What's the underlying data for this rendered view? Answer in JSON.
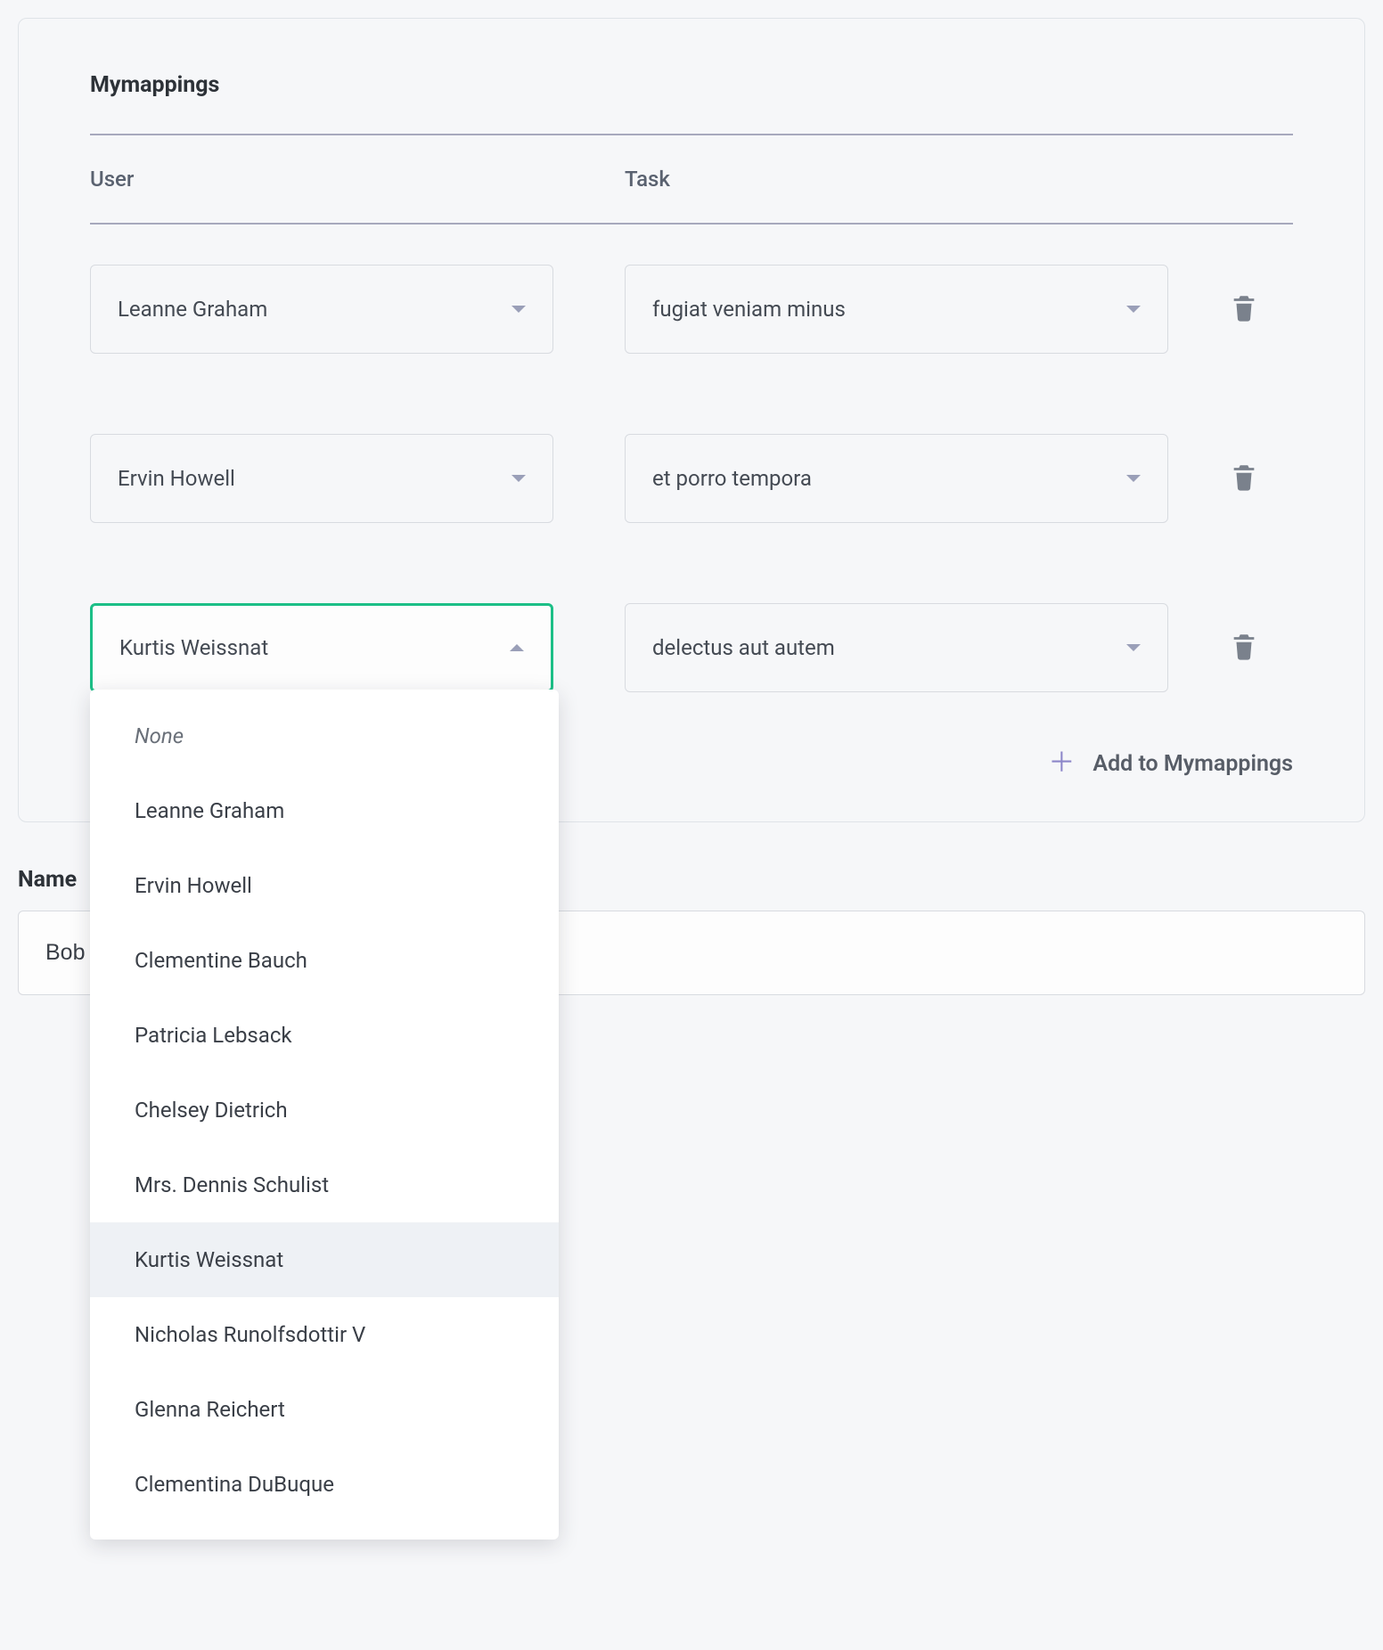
{
  "panel": {
    "title": "Mymappings",
    "columns": {
      "user": "User",
      "task": "Task"
    },
    "rows": [
      {
        "user": "Leanne Graham",
        "task": "fugiat veniam minus"
      },
      {
        "user": "Ervin Howell",
        "task": "et porro tempora"
      },
      {
        "user": "Kurtis Weissnat",
        "task": "delectus aut autem"
      }
    ],
    "add_label": "Add to Mymappings"
  },
  "dropdown": {
    "none_label": "None",
    "options": [
      "Leanne Graham",
      "Ervin Howell",
      "Clementine Bauch",
      "Patricia Lebsack",
      "Chelsey Dietrich",
      "Mrs. Dennis Schulist",
      "Kurtis Weissnat",
      "Nicholas Runolfsdottir V",
      "Glenna Reichert",
      "Clementina DuBuque"
    ],
    "selected": "Kurtis Weissnat"
  },
  "name_field": {
    "label": "Name",
    "value": "Bob"
  }
}
